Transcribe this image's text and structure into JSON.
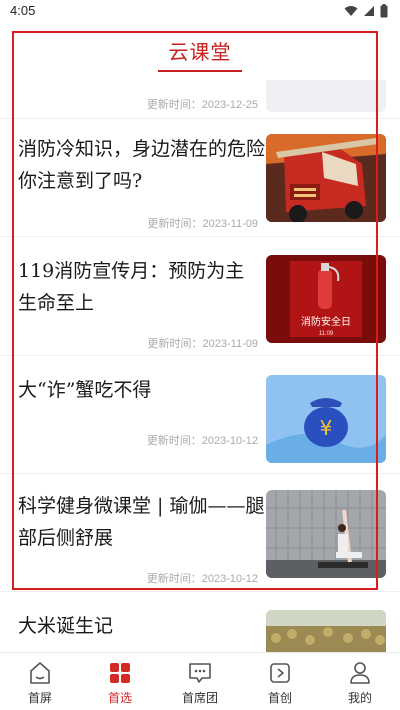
{
  "status_bar": {
    "time": "4:05"
  },
  "header": {
    "title": "云课堂"
  },
  "articles": [
    {
      "title": "",
      "time_label": "更新时间：",
      "time": "2023-12-25"
    },
    {
      "title": "消防冷知识，身边潜在的危险你注意到了吗?",
      "time_label": "更新时间：",
      "time": "2023-11-09"
    },
    {
      "title": "119消防宣传月：预防为主 生命至上",
      "time_label": "更新时间：",
      "time": "2023-11-09"
    },
    {
      "title": "大“诈”蟹吃不得",
      "time_label": "更新时间：",
      "time": "2023-10-12"
    },
    {
      "title": "科学健身微课堂 | 瑜伽——腿部后侧舒展",
      "time_label": "更新时间：",
      "time": "2023-10-12"
    },
    {
      "title": "大米诞生记",
      "time_label": "",
      "time": ""
    }
  ],
  "thumb_text": {
    "fire_safety_day": "消防安全日",
    "date": "11.09",
    "yen": "¥"
  },
  "tabs": [
    {
      "label": "首屏",
      "icon": "home-icon",
      "active": false
    },
    {
      "label": "首选",
      "icon": "grid-icon",
      "active": true
    },
    {
      "label": "首席团",
      "icon": "chat-icon",
      "active": false
    },
    {
      "label": "首创",
      "icon": "play-icon",
      "active": false
    },
    {
      "label": "我的",
      "icon": "user-icon",
      "active": false
    }
  ],
  "colors": {
    "accent": "#c8201f",
    "highlight_frame": "#d91c1c",
    "time_text": "#aaaaaa"
  }
}
